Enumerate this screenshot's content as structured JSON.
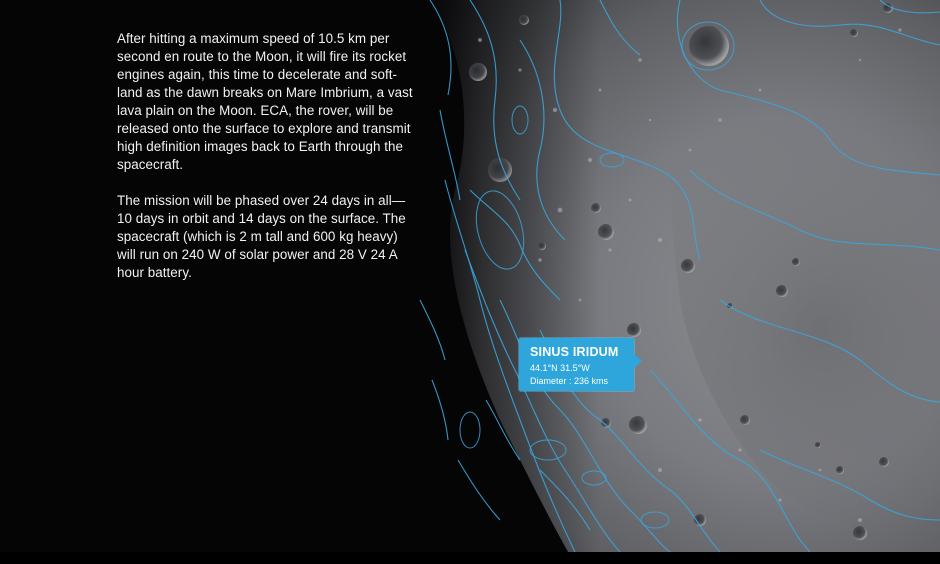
{
  "article": {
    "paragraph_1": "After hitting a maximum speed of 10.5 km per second en route to the Moon, it will fire its rocket engines again, this time to decelerate and soft-land as the dawn breaks on Mare Imbrium, a vast lava plain on the Moon. ECA, the rover, will be released onto the surface to explore and transmit high definition images back to Earth through the spacecraft.",
    "paragraph_2": "The mission will be phased over 24 days in all—10 days in orbit and 14 days on the surface. The spacecraft (which is 2 m tall and 600 kg heavy) will run on 240 W of solar power and 28 V 24 A hour battery."
  },
  "map_label": {
    "name": "SINUS IRIDUM",
    "coordinates": "44.1°N 31.5°W",
    "diameter": "Diameter : 236 kms"
  },
  "colors": {
    "background": "#050506",
    "contour": "#3aa6dc",
    "label_fill": "#2ea6dc",
    "text": "#f2f2f2"
  }
}
